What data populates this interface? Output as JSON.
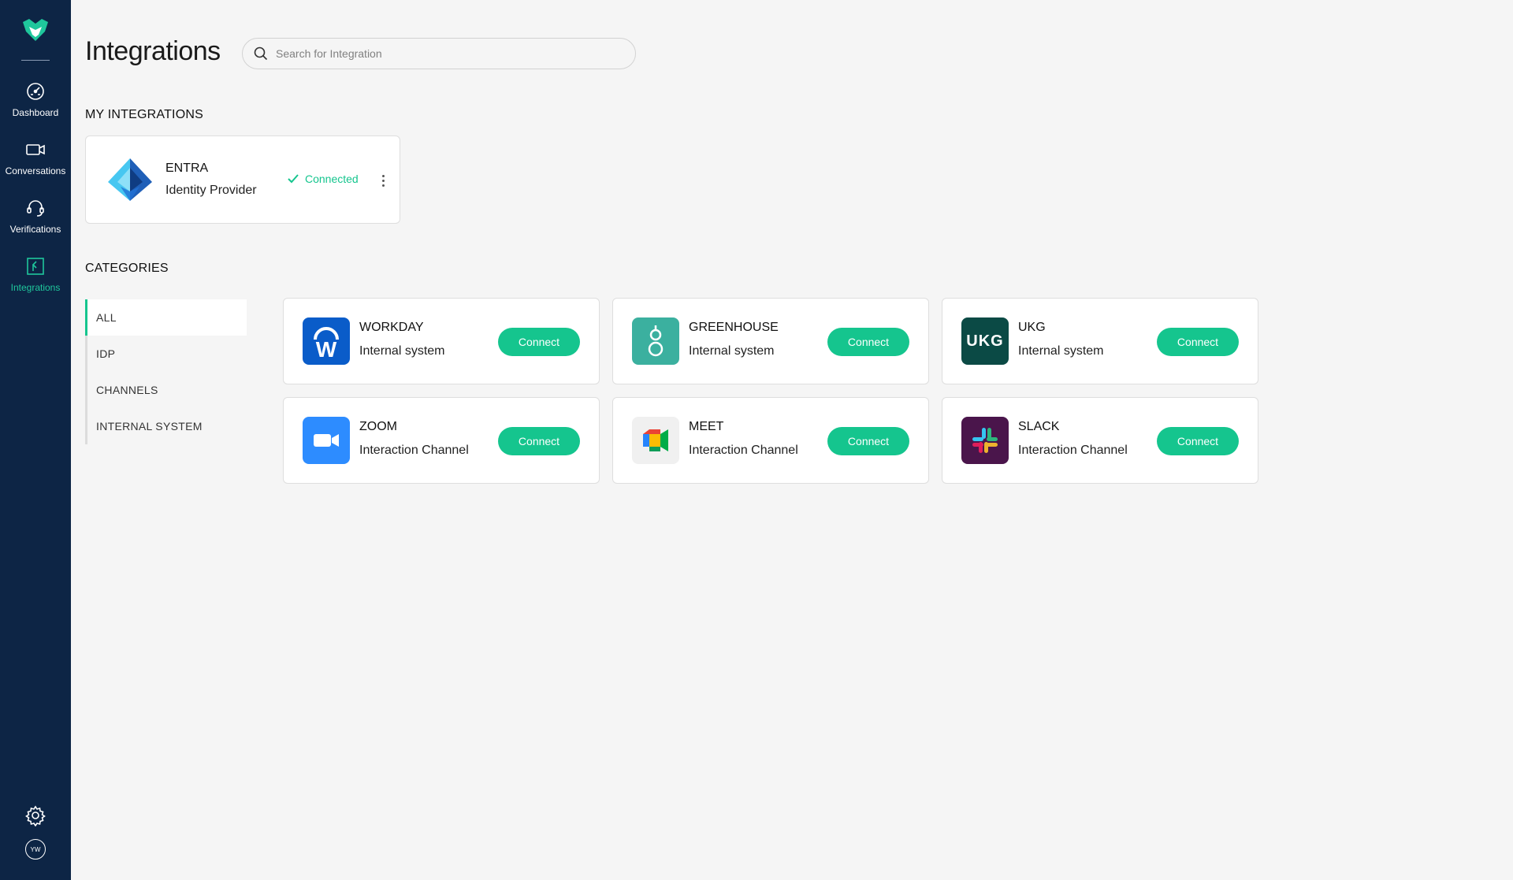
{
  "nav": {
    "items": [
      {
        "label": "Dashboard",
        "icon": "speedometer-icon",
        "active": false
      },
      {
        "label": "Conversations",
        "icon": "video-camera-icon",
        "active": false
      },
      {
        "label": "Verifications",
        "icon": "headset-icon",
        "active": false
      },
      {
        "label": "Integrations",
        "icon": "integrations-icon",
        "active": true
      }
    ],
    "avatar_initials": "YW"
  },
  "header": {
    "title": "Integrations",
    "search_placeholder": "Search for Integration"
  },
  "my_integrations": {
    "heading": "MY INTEGRATIONS",
    "items": [
      {
        "name": "ENTRA",
        "type": "Identity Provider",
        "status": "Connected",
        "icon": "entra-logo-icon"
      }
    ]
  },
  "categories": {
    "heading": "CATEGORIES",
    "items": [
      {
        "label": "ALL",
        "active": true
      },
      {
        "label": "IDP",
        "active": false
      },
      {
        "label": "CHANNELS",
        "active": false
      },
      {
        "label": "INTERNAL SYSTEM",
        "active": false
      }
    ]
  },
  "integrations": [
    {
      "name": "WORKDAY",
      "type": "Internal system",
      "button": "Connect",
      "icon": "workday-logo-icon"
    },
    {
      "name": "GREENHOUSE",
      "type": "Internal system",
      "button": "Connect",
      "icon": "greenhouse-logo-icon"
    },
    {
      "name": "UKG",
      "type": "Internal system",
      "button": "Connect",
      "icon": "ukg-logo-icon",
      "logo_text": "UKG"
    },
    {
      "name": "ZOOM",
      "type": "Interaction Channel",
      "button": "Connect",
      "icon": "zoom-logo-icon"
    },
    {
      "name": "MEET",
      "type": "Interaction Channel",
      "button": "Connect",
      "icon": "google-meet-logo-icon"
    },
    {
      "name": "SLACK",
      "type": "Interaction Channel",
      "button": "Connect",
      "icon": "slack-logo-icon"
    }
  ],
  "colors": {
    "sidebar_bg": "#0d2545",
    "accent": "#15c58e",
    "background": "#f5f5f5"
  }
}
